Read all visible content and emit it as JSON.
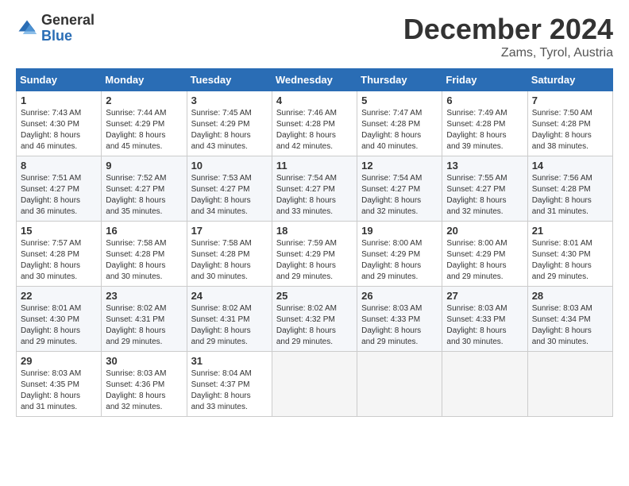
{
  "header": {
    "logo_general": "General",
    "logo_blue": "Blue",
    "title": "December 2024",
    "location": "Zams, Tyrol, Austria"
  },
  "days_of_week": [
    "Sunday",
    "Monday",
    "Tuesday",
    "Wednesday",
    "Thursday",
    "Friday",
    "Saturday"
  ],
  "weeks": [
    [
      {
        "day": "1",
        "sunrise": "7:43 AM",
        "sunset": "4:30 PM",
        "daylight": "8 hours and 46 minutes."
      },
      {
        "day": "2",
        "sunrise": "7:44 AM",
        "sunset": "4:29 PM",
        "daylight": "8 hours and 45 minutes."
      },
      {
        "day": "3",
        "sunrise": "7:45 AM",
        "sunset": "4:29 PM",
        "daylight": "8 hours and 43 minutes."
      },
      {
        "day": "4",
        "sunrise": "7:46 AM",
        "sunset": "4:28 PM",
        "daylight": "8 hours and 42 minutes."
      },
      {
        "day": "5",
        "sunrise": "7:47 AM",
        "sunset": "4:28 PM",
        "daylight": "8 hours and 40 minutes."
      },
      {
        "day": "6",
        "sunrise": "7:49 AM",
        "sunset": "4:28 PM",
        "daylight": "8 hours and 39 minutes."
      },
      {
        "day": "7",
        "sunrise": "7:50 AM",
        "sunset": "4:28 PM",
        "daylight": "8 hours and 38 minutes."
      }
    ],
    [
      {
        "day": "8",
        "sunrise": "7:51 AM",
        "sunset": "4:27 PM",
        "daylight": "8 hours and 36 minutes."
      },
      {
        "day": "9",
        "sunrise": "7:52 AM",
        "sunset": "4:27 PM",
        "daylight": "8 hours and 35 minutes."
      },
      {
        "day": "10",
        "sunrise": "7:53 AM",
        "sunset": "4:27 PM",
        "daylight": "8 hours and 34 minutes."
      },
      {
        "day": "11",
        "sunrise": "7:54 AM",
        "sunset": "4:27 PM",
        "daylight": "8 hours and 33 minutes."
      },
      {
        "day": "12",
        "sunrise": "7:54 AM",
        "sunset": "4:27 PM",
        "daylight": "8 hours and 32 minutes."
      },
      {
        "day": "13",
        "sunrise": "7:55 AM",
        "sunset": "4:27 PM",
        "daylight": "8 hours and 32 minutes."
      },
      {
        "day": "14",
        "sunrise": "7:56 AM",
        "sunset": "4:28 PM",
        "daylight": "8 hours and 31 minutes."
      }
    ],
    [
      {
        "day": "15",
        "sunrise": "7:57 AM",
        "sunset": "4:28 PM",
        "daylight": "8 hours and 30 minutes."
      },
      {
        "day": "16",
        "sunrise": "7:58 AM",
        "sunset": "4:28 PM",
        "daylight": "8 hours and 30 minutes."
      },
      {
        "day": "17",
        "sunrise": "7:58 AM",
        "sunset": "4:28 PM",
        "daylight": "8 hours and 30 minutes."
      },
      {
        "day": "18",
        "sunrise": "7:59 AM",
        "sunset": "4:29 PM",
        "daylight": "8 hours and 29 minutes."
      },
      {
        "day": "19",
        "sunrise": "8:00 AM",
        "sunset": "4:29 PM",
        "daylight": "8 hours and 29 minutes."
      },
      {
        "day": "20",
        "sunrise": "8:00 AM",
        "sunset": "4:29 PM",
        "daylight": "8 hours and 29 minutes."
      },
      {
        "day": "21",
        "sunrise": "8:01 AM",
        "sunset": "4:30 PM",
        "daylight": "8 hours and 29 minutes."
      }
    ],
    [
      {
        "day": "22",
        "sunrise": "8:01 AM",
        "sunset": "4:30 PM",
        "daylight": "8 hours and 29 minutes."
      },
      {
        "day": "23",
        "sunrise": "8:02 AM",
        "sunset": "4:31 PM",
        "daylight": "8 hours and 29 minutes."
      },
      {
        "day": "24",
        "sunrise": "8:02 AM",
        "sunset": "4:31 PM",
        "daylight": "8 hours and 29 minutes."
      },
      {
        "day": "25",
        "sunrise": "8:02 AM",
        "sunset": "4:32 PM",
        "daylight": "8 hours and 29 minutes."
      },
      {
        "day": "26",
        "sunrise": "8:03 AM",
        "sunset": "4:33 PM",
        "daylight": "8 hours and 29 minutes."
      },
      {
        "day": "27",
        "sunrise": "8:03 AM",
        "sunset": "4:33 PM",
        "daylight": "8 hours and 30 minutes."
      },
      {
        "day": "28",
        "sunrise": "8:03 AM",
        "sunset": "4:34 PM",
        "daylight": "8 hours and 30 minutes."
      }
    ],
    [
      {
        "day": "29",
        "sunrise": "8:03 AM",
        "sunset": "4:35 PM",
        "daylight": "8 hours and 31 minutes."
      },
      {
        "day": "30",
        "sunrise": "8:03 AM",
        "sunset": "4:36 PM",
        "daylight": "8 hours and 32 minutes."
      },
      {
        "day": "31",
        "sunrise": "8:04 AM",
        "sunset": "4:37 PM",
        "daylight": "8 hours and 33 minutes."
      },
      null,
      null,
      null,
      null
    ]
  ],
  "labels": {
    "sunrise": "Sunrise:",
    "sunset": "Sunset:",
    "daylight": "Daylight:"
  }
}
